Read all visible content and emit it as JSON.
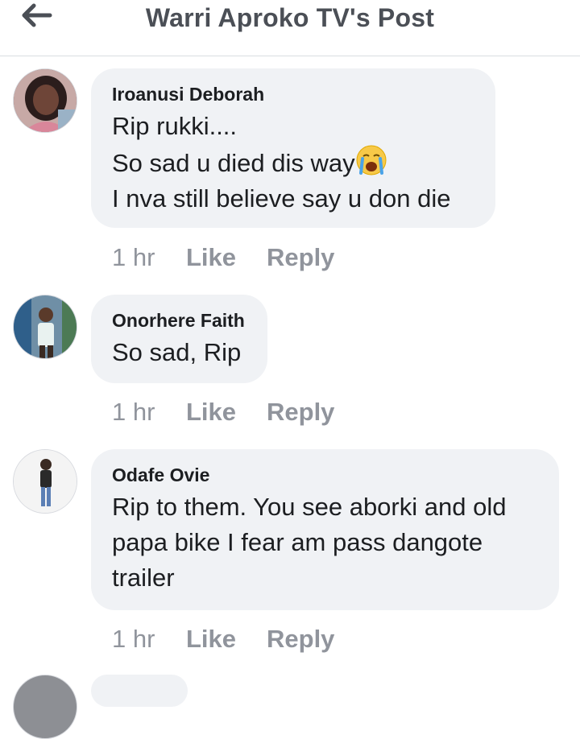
{
  "header": {
    "title": "Warri Aproko TV's Post",
    "back_icon": "back-arrow-icon"
  },
  "comments": [
    {
      "author": "Iroanusi Deborah",
      "lines": [
        "Rip rukki....",
        "So sad u died dis way",
        "I nva still believe say u don die"
      ],
      "emoji": "crying-face-emoji",
      "time": "1 hr",
      "like": "Like",
      "reply": "Reply"
    },
    {
      "author": "Onorhere Faith",
      "lines": [
        "So sad, Rip"
      ],
      "time": "1 hr",
      "like": "Like",
      "reply": "Reply"
    },
    {
      "author": "Odafe Ovie",
      "lines": [
        "Rip to them. You see aborki and old",
        "papa bike I fear am pass dangote",
        "trailer"
      ],
      "time": "1 hr",
      "like": "Like",
      "reply": "Reply"
    }
  ],
  "colors": {
    "bubble": "#f0f2f5",
    "muted": "#90949c",
    "title": "#4b4f56"
  }
}
